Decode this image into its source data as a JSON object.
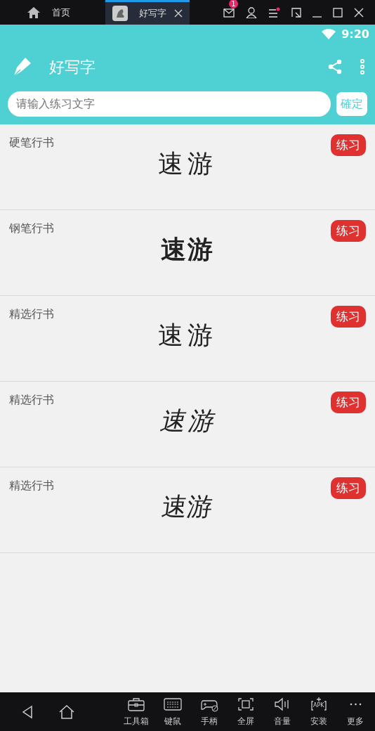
{
  "host_tabs": [
    {
      "label": "首页",
      "kind": "home",
      "selected": false
    },
    {
      "label": "好写字",
      "kind": "app",
      "selected": true
    }
  ],
  "mail_badge": "1",
  "status_bar": {
    "time": "9:20"
  },
  "app_bar": {
    "title": "好写字"
  },
  "search": {
    "placeholder": "请输入练习文字",
    "button": "確定"
  },
  "samples": [
    {
      "style": "硬笔行书",
      "text": "速游",
      "kind": "light",
      "button": "练习"
    },
    {
      "style": "钢笔行书",
      "text": "速游",
      "kind": "bold",
      "button": "练习"
    },
    {
      "style": "精选行书",
      "text": "速游",
      "kind": "light",
      "button": "练习"
    },
    {
      "style": "精选行书",
      "text": "速游",
      "kind": "italic",
      "button": "练习"
    },
    {
      "style": "精选行书",
      "text": "速游",
      "kind": "wide",
      "button": "练习"
    }
  ],
  "toolbar": [
    {
      "label": "工具箱",
      "kind": "toolbox"
    },
    {
      "label": "键鼠",
      "kind": "keyboard"
    },
    {
      "label": "手柄",
      "kind": "gamepad"
    },
    {
      "label": "全屏",
      "kind": "fullscreen"
    },
    {
      "label": "音量",
      "kind": "volume"
    },
    {
      "label": "安装",
      "kind": "apk",
      "icon_text": "APK"
    },
    {
      "label": "更多",
      "kind": "more"
    }
  ]
}
